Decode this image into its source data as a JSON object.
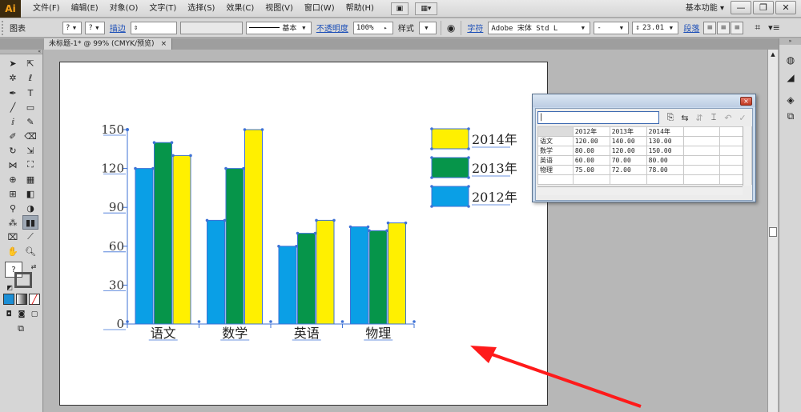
{
  "menubar": {
    "logo": "Ai",
    "items": [
      "文件(F)",
      "编辑(E)",
      "对象(O)",
      "文字(T)",
      "选择(S)",
      "效果(C)",
      "视图(V)",
      "窗口(W)",
      "帮助(H)"
    ],
    "workspace": "基本功能",
    "win_minimize": "—",
    "win_restore": "❐",
    "win_close": "✕"
  },
  "controlbar": {
    "selection_label": "图表",
    "q1": "?",
    "q2": "?",
    "stroke_label": "描边",
    "stroke_style": "基本",
    "opacity_label": "不透明度",
    "opacity_value": "100%",
    "style_label": "样式",
    "char_label": "字符",
    "font_name": "Adobe 宋体 Std L",
    "font_style": "-",
    "font_size": "23.01",
    "para_label": "段落"
  },
  "document_tab": {
    "title": "未标题-1* @ 99% (CMYK/预览)",
    "close": "×"
  },
  "graph_data": {
    "input_value": "|",
    "headers": [
      "",
      "2012年",
      "2013年",
      "2014年"
    ],
    "rows": [
      [
        "语文",
        "120.00",
        "140.00",
        "130.00"
      ],
      [
        "数学",
        "80.00",
        "120.00",
        "150.00"
      ],
      [
        "英语",
        "60.00",
        "70.00",
        "80.00"
      ],
      [
        "物理",
        "75.00",
        "72.00",
        "78.00"
      ]
    ],
    "close": "×"
  },
  "chart_data": {
    "type": "bar",
    "categories": [
      "语文",
      "数学",
      "英语",
      "物理"
    ],
    "series": [
      {
        "name": "2012年",
        "color": "#0a9fe6",
        "values": [
          120,
          80,
          60,
          75
        ]
      },
      {
        "name": "2013年",
        "color": "#06954a",
        "values": [
          140,
          120,
          70,
          72
        ]
      },
      {
        "name": "2014年",
        "color": "#fff000",
        "values": [
          130,
          150,
          80,
          78
        ]
      }
    ],
    "yticks": [
      "0",
      "30",
      "60",
      "90",
      "120",
      "150"
    ],
    "ylim": [
      0,
      150
    ],
    "legend_order": [
      "2014年",
      "2013年",
      "2012年"
    ],
    "legend_position": "top-right",
    "grid": false,
    "selection_color": "#3e72d6"
  },
  "annotation": {
    "arrow_color": "#ff1a1a"
  }
}
